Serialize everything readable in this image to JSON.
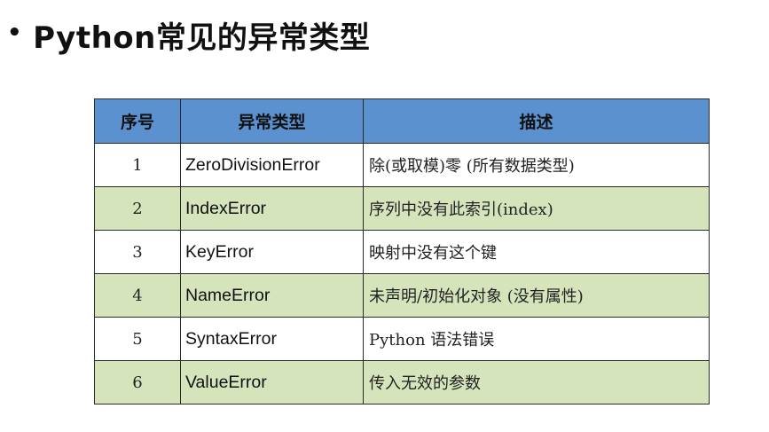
{
  "slide": {
    "bullet": "•",
    "title": "Python常见的异常类型"
  },
  "table": {
    "headers": [
      "序号",
      "异常类型",
      "描述"
    ],
    "rows": [
      {
        "num": "1",
        "type": "ZeroDivisionError",
        "desc": "除(或取模)零 (所有数据类型)"
      },
      {
        "num": "2",
        "type": "IndexError",
        "desc": "序列中没有此索引(index)"
      },
      {
        "num": "3",
        "type": "KeyError",
        "desc": "映射中没有这个键"
      },
      {
        "num": "4",
        "type": "NameError",
        "desc": "未声明/初始化对象 (没有属性)"
      },
      {
        "num": "5",
        "type": "SyntaxError",
        "desc": "Python 语法错误"
      },
      {
        "num": "6",
        "type": "ValueError",
        "desc": "传入无效的参数"
      }
    ]
  },
  "colors": {
    "header_bg": "#5b91cf",
    "row_alt_bg": "#d6e4bc",
    "row_bg": "#ffffff"
  }
}
